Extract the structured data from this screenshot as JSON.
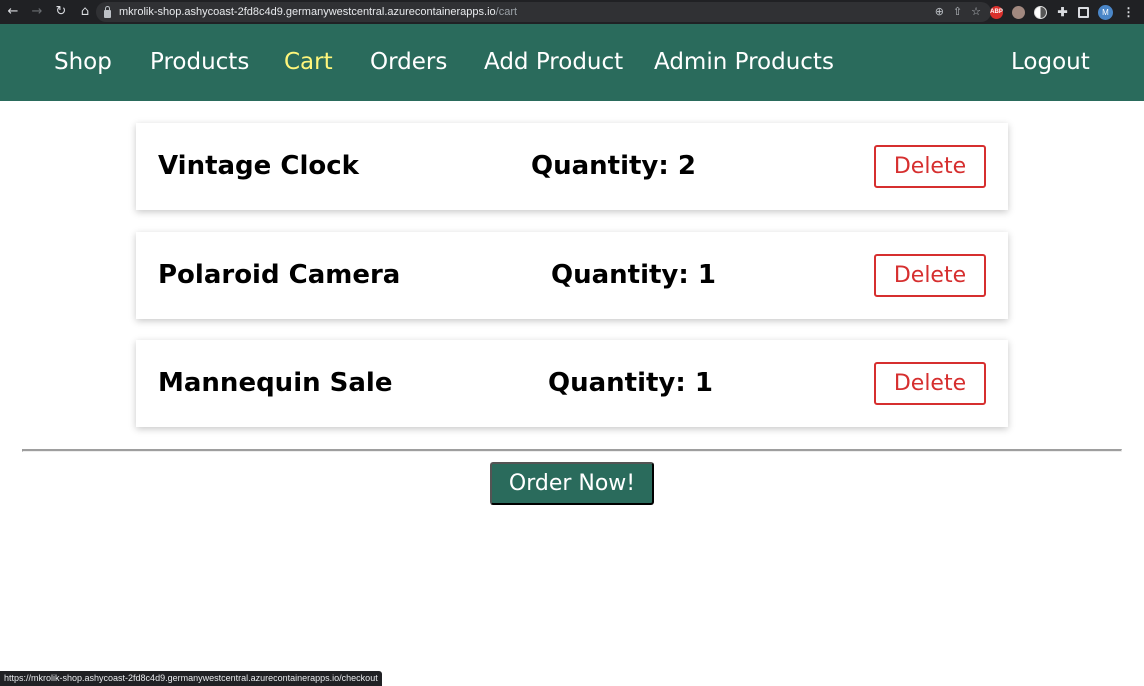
{
  "browser": {
    "url_host": "mkrolik-shop.ashycoast-2fd8c4d9.germanywestcentral.azurecontainerapps.io",
    "url_path": "/cart",
    "avatar_letter": "M",
    "abp_label": "ABP",
    "status_url": "https://mkrolik-shop.ashycoast-2fd8c4d9.germanywestcentral.azurecontainerapps.io/checkout"
  },
  "nav": {
    "items": [
      {
        "label": "Shop",
        "active": false
      },
      {
        "label": "Products",
        "active": false
      },
      {
        "label": "Cart",
        "active": true
      },
      {
        "label": "Orders",
        "active": false
      },
      {
        "label": "Add Product",
        "active": false
      },
      {
        "label": "Admin Products",
        "active": false
      }
    ],
    "logout_label": "Logout"
  },
  "cart": {
    "items": [
      {
        "title": "Vintage Clock",
        "quantity_text": "Quantity: 2",
        "delete_label": "Delete"
      },
      {
        "title": "Polaroid Camera",
        "quantity_text": "Quantity: 1",
        "delete_label": "Delete"
      },
      {
        "title": "Mannequin Sale",
        "quantity_text": "Quantity: 1",
        "delete_label": "Delete"
      }
    ],
    "order_button_label": "Order Now!"
  },
  "colors": {
    "header_bg": "#2a6b5c",
    "active_nav": "#fff67b",
    "delete_accent": "#d62f2f"
  }
}
